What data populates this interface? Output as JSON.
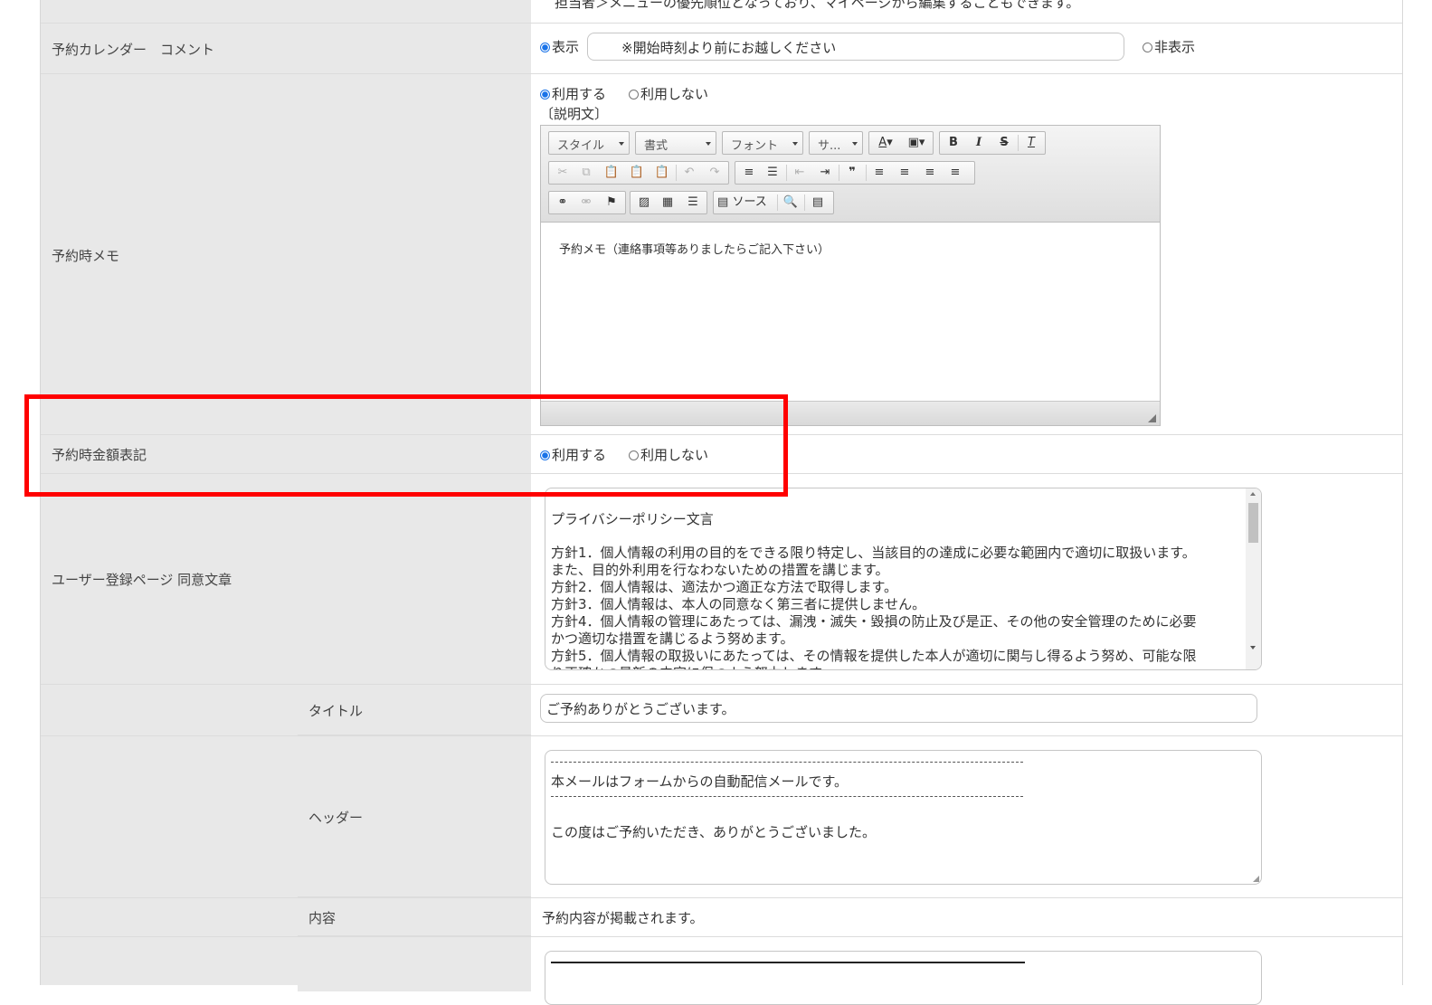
{
  "top_note": "担当者＞メニューの優先順位となっており、マイページから編集することもできます。",
  "calendar_comment": {
    "label": "予約カレンダー　コメント",
    "radio_show": "表示",
    "radio_hide": "非表示",
    "comment_value": "※開始時刻より前にお越しください"
  },
  "memo": {
    "label": "予約時メモ",
    "radio_use": "利用する",
    "radio_not_use": "利用しない",
    "description_label": "〔説明文〕",
    "toolbar": {
      "style": "スタイル",
      "format": "書式",
      "font": "フォント",
      "size": "サ...",
      "source": "ソース"
    },
    "editor_text": "予約メモ（連絡事項等ありましたらご記入下さい）"
  },
  "price": {
    "label": "予約時金額表記",
    "radio_use": "利用する",
    "radio_not_use": "利用しない"
  },
  "consent": {
    "label": "ユーザー登録ページ 同意文章",
    "lines": [
      "プライバシーポリシー文言",
      "",
      "方針1．個人情報の利用の目的をできる限り特定し、当該目的の達成に必要な範囲内で適切に取扱います。",
      "また、目的外利用を行なわないための措置を講じます。",
      "方針2．個人情報は、適法かつ適正な方法で取得します。",
      "方針3．個人情報は、本人の同意なく第三者に提供しません。",
      "方針4．個人情報の管理にあたっては、漏洩・滅失・毀損の防止及び是正、その他の安全管理のために必要",
      "かつ適切な措置を講じるよう努めます。",
      "方針5．個人情報の取扱いにあたっては、その情報を提供した本人が適切に関与し得るよう努め、可能な限",
      "り正確かつ最新の内容に保つよう努力します。"
    ]
  },
  "mail": {
    "title_label": "タイトル",
    "title_value": "ご予約ありがとうございます。",
    "header_label": "ヘッダー",
    "header_line1": "本メールはフォームからの自動配信メールです。",
    "header_line2": "この度はご予約いただき、ありがとうございました。",
    "content_label": "内容",
    "content_value": "予約内容が掲載されます。"
  },
  "colors": {
    "highlight_border": "#ff0000",
    "label_bg": "#e8e8e8",
    "radio_checked": "#1a73e8"
  }
}
